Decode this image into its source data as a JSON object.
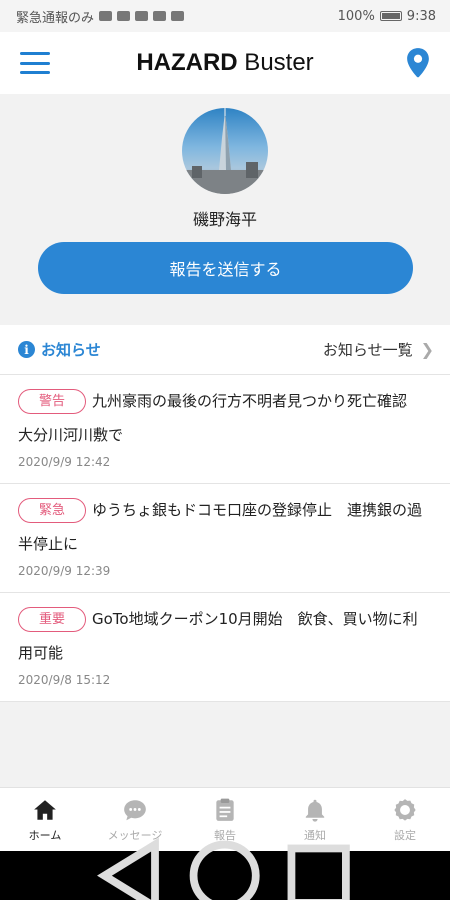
{
  "status_bar": {
    "carrier": "緊急通報のみ",
    "battery": "100%",
    "time": "9:38"
  },
  "app_bar": {
    "title_bold": "HAZARD",
    "title_rest": " Buster",
    "menu_icon": "hamburger-menu-icon",
    "location_icon": "map-pin-icon"
  },
  "profile": {
    "name": "磯野海平",
    "report_button": "報告を送信する"
  },
  "news": {
    "title": "お知らせ",
    "all_link": "お知らせ一覧",
    "items": [
      {
        "badge": "警告",
        "text": "九州豪雨の最後の行方不明者見つかり死亡確認　大分川河川敷で",
        "date": "2020/9/9 12:42"
      },
      {
        "badge": "緊急",
        "text": "ゆうちょ銀もドコモ口座の登録停止　連携銀の過半停止に",
        "date": "2020/9/9 12:39"
      },
      {
        "badge": "重要",
        "text": "GoTo地域クーポン10月開始　飲食、買い物に利用可能",
        "date": "2020/9/8 15:12"
      }
    ]
  },
  "tabs": [
    {
      "label": "ホーム",
      "icon": "home-icon",
      "active": true
    },
    {
      "label": "メッセージ",
      "icon": "chat-bubble-icon",
      "active": false
    },
    {
      "label": "報告",
      "icon": "clipboard-icon",
      "active": false
    },
    {
      "label": "通知",
      "icon": "bell-icon",
      "active": false
    },
    {
      "label": "設定",
      "icon": "gear-icon",
      "active": false
    }
  ],
  "colors": {
    "accent": "#2b86d4",
    "badge": "#e35b7c"
  }
}
